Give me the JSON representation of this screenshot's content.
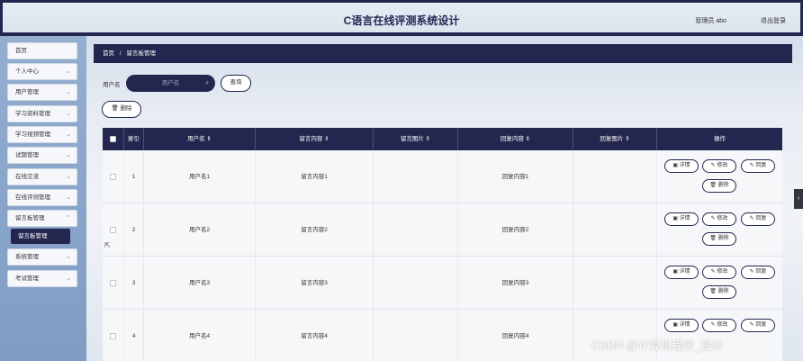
{
  "header": {
    "title": "C语言在线评测系统设计",
    "user": "管理员 abo",
    "logout": "退出登录"
  },
  "sidebar": {
    "items": [
      {
        "label": "首页"
      },
      {
        "label": "个人中心"
      },
      {
        "label": "用户管理"
      },
      {
        "label": "学习资料管理"
      },
      {
        "label": "学习视频管理"
      },
      {
        "label": "试题管理"
      },
      {
        "label": "在线交流"
      },
      {
        "label": "在线评测管理"
      },
      {
        "label": "留言板管理"
      },
      {
        "label": "系统管理"
      },
      {
        "label": "考试管理"
      }
    ],
    "active_sub": "留言板管理"
  },
  "breadcrumb": {
    "home": "首页",
    "sep": "/",
    "current": "留言板管理"
  },
  "search": {
    "label": "用户名",
    "placeholder": "用户名",
    "button": "查询"
  },
  "toolbar": {
    "delete": "删除"
  },
  "table": {
    "headers": [
      "索引",
      "用户名",
      "留言内容",
      "留言图片",
      "回复内容",
      "回复图片",
      "操作"
    ],
    "rows": [
      {
        "index": "1",
        "user": "用户名1",
        "content": "留言内容1",
        "reply": "回复内容1"
      },
      {
        "index": "2",
        "user": "用户名2",
        "content": "留言内容2",
        "reply": "回复内容2"
      },
      {
        "index": "3",
        "user": "用户名3",
        "content": "留言内容3",
        "reply": "回复内容3"
      },
      {
        "index": "4",
        "user": "用户名4",
        "content": "留言内容4",
        "reply": "回复内容4"
      }
    ],
    "actions": {
      "detail": "详情",
      "edit": "修改",
      "reply": "回复",
      "delete": "删除"
    }
  },
  "watermark": "CSDN @计算机程序_设计"
}
